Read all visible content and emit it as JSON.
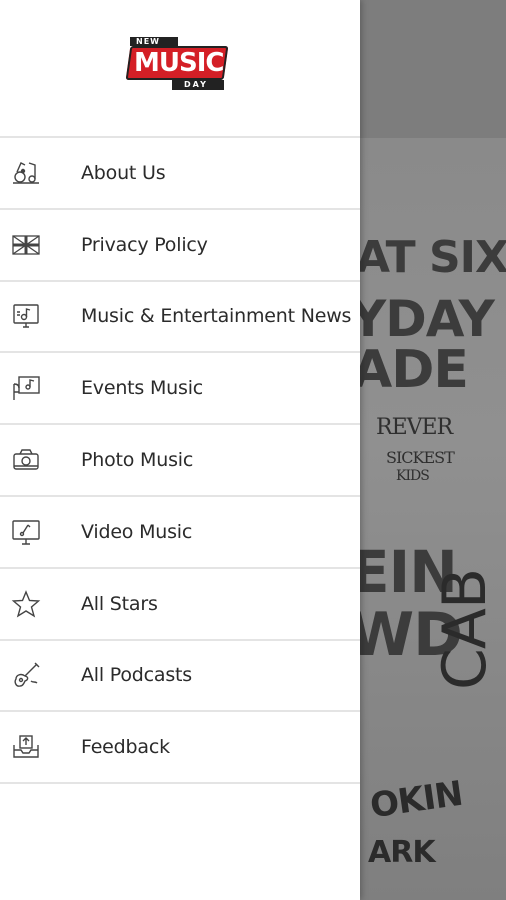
{
  "app": {
    "logo": {
      "top_text": "NEW",
      "main_text": "MUSIC",
      "bottom_text": "DAY",
      "brand_color": "#d41f26"
    }
  },
  "drawer": {
    "items": [
      {
        "label": "About Us",
        "icon": "music-notes-icon"
      },
      {
        "label": "Privacy Policy",
        "icon": "flag-icon"
      },
      {
        "label": "Music & Entertainment News",
        "icon": "news-monitor-icon"
      },
      {
        "label": "Events Music",
        "icon": "event-music-icon"
      },
      {
        "label": "Photo Music",
        "icon": "camera-icon"
      },
      {
        "label": "Video Music",
        "icon": "video-monitor-icon"
      },
      {
        "label": "All Stars",
        "icon": "star-icon"
      },
      {
        "label": "All Podcasts",
        "icon": "guitar-icon"
      },
      {
        "label": "Feedback",
        "icon": "feedback-tray-icon"
      }
    ]
  },
  "background": {
    "poster_lines": [
      "AT SIX",
      "YDAY",
      "ADE",
      "REVER",
      "SICKEST",
      "KIDS",
      "EIN",
      "WD",
      "CAB",
      "OKIN",
      "ARK"
    ]
  }
}
